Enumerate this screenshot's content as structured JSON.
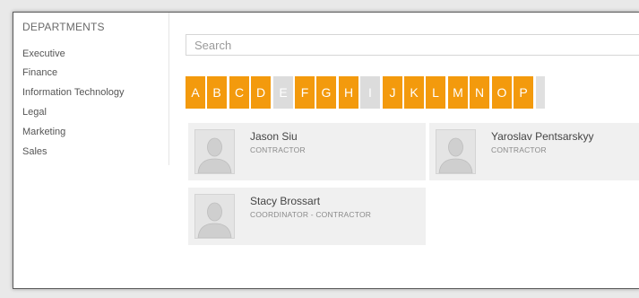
{
  "sidebar": {
    "title": "DEPARTMENTS",
    "items": [
      {
        "label": "Executive"
      },
      {
        "label": "Finance"
      },
      {
        "label": "Information Technology"
      },
      {
        "label": "Legal"
      },
      {
        "label": "Marketing"
      },
      {
        "label": "Sales"
      }
    ]
  },
  "search": {
    "placeholder": "Search",
    "value": ""
  },
  "alphabet": {
    "letters": [
      {
        "label": "A",
        "enabled": true
      },
      {
        "label": "B",
        "enabled": true
      },
      {
        "label": "C",
        "enabled": true
      },
      {
        "label": "D",
        "enabled": true
      },
      {
        "label": "E",
        "enabled": false
      },
      {
        "label": "F",
        "enabled": true
      },
      {
        "label": "G",
        "enabled": true
      },
      {
        "label": "H",
        "enabled": true
      },
      {
        "label": "I",
        "enabled": false
      },
      {
        "label": "J",
        "enabled": true
      },
      {
        "label": "K",
        "enabled": true
      },
      {
        "label": "L",
        "enabled": true
      },
      {
        "label": "M",
        "enabled": true
      },
      {
        "label": "N",
        "enabled": true
      },
      {
        "label": "O",
        "enabled": true
      },
      {
        "label": "P",
        "enabled": true
      }
    ],
    "active_color": "#f39a0d",
    "disabled_color": "#dcdcdc"
  },
  "people": [
    {
      "name": "Jason Siu",
      "role": "CONTRACTOR",
      "avatar_icon": "person-placeholder-icon"
    },
    {
      "name": "Yaroslav Pentsarskyy",
      "role": "CONTRACTOR",
      "avatar_icon": "person-placeholder-icon"
    },
    {
      "name": "Stacy Brossart",
      "role": "COORDINATOR - CONTRACTOR",
      "avatar_icon": "person-placeholder-icon"
    }
  ]
}
